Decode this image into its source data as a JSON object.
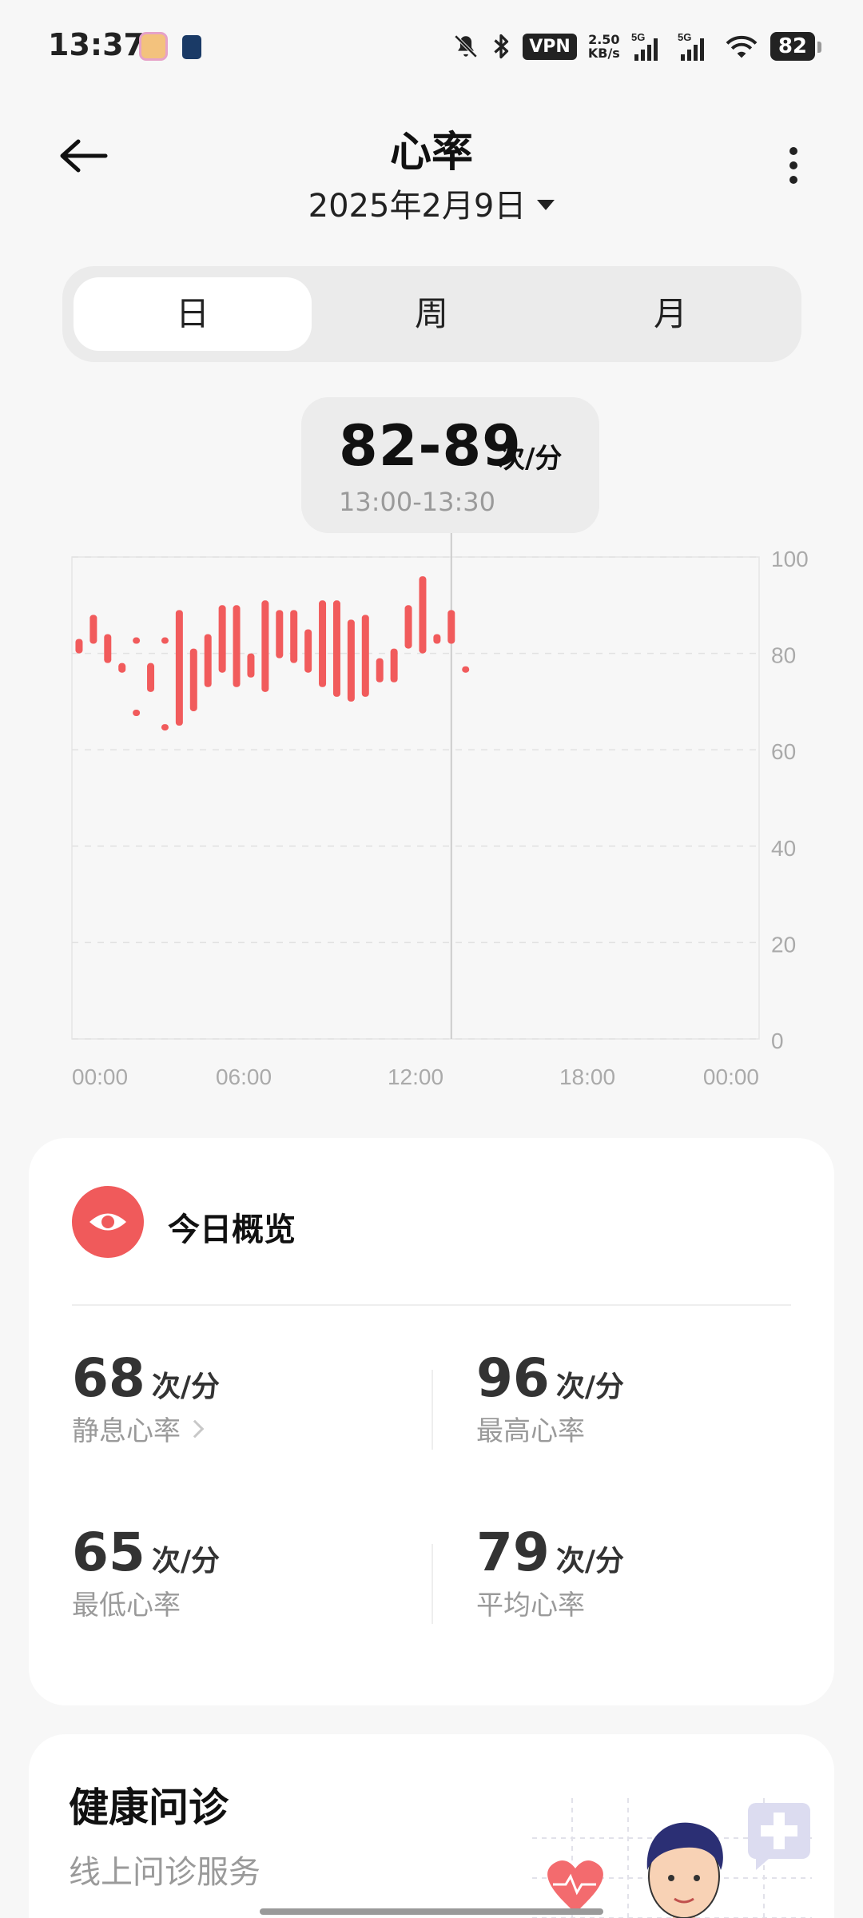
{
  "status_bar": {
    "time": "13:37",
    "vpn": "VPN",
    "net_speed_value": "2.50",
    "net_speed_unit": "KB/s",
    "signal1_label": "5G",
    "signal2_label": "5G",
    "battery": "82",
    "icons": [
      "dnd-bell-off-icon",
      "bluetooth-icon",
      "signal-icon",
      "signal-icon",
      "wifi-icon",
      "battery-icon"
    ]
  },
  "header": {
    "title": "心率",
    "date": "2025年2月9日"
  },
  "tabs": [
    {
      "label": "日",
      "active": true
    },
    {
      "label": "周",
      "active": false
    },
    {
      "label": "月",
      "active": false
    }
  ],
  "tooltip": {
    "range": "82-89",
    "unit": "次/分",
    "time": "13:00-13:30"
  },
  "chart_data": {
    "type": "bar",
    "bar_style": "floating range (min-max per 30-minute interval)",
    "color": "#f15b5c",
    "x_ticks": [
      "00:00",
      "06:00",
      "12:00",
      "18:00",
      "00:00"
    ],
    "y_ticks": [
      100,
      80,
      60,
      40,
      20,
      0
    ],
    "ylim": [
      0,
      100
    ],
    "x_range_hours": [
      0,
      24
    ],
    "grid": "dashed",
    "cursor_hour": 13.25,
    "intervals": [
      {
        "t": 0.25,
        "min": 80,
        "max": 83
      },
      {
        "t": 0.75,
        "min": 82,
        "max": 88
      },
      {
        "t": 1.25,
        "min": 78,
        "max": 84
      },
      {
        "t": 1.75,
        "min": 76,
        "max": 78
      },
      {
        "t": 2.25,
        "min": 82,
        "max": 83
      },
      {
        "t": 2.25,
        "min": 67,
        "max": 68
      },
      {
        "t": 2.75,
        "min": 72,
        "max": 78
      },
      {
        "t": 3.25,
        "min": 82,
        "max": 83
      },
      {
        "t": 3.25,
        "min": 64,
        "max": 65
      },
      {
        "t": 3.75,
        "min": 65,
        "max": 89
      },
      {
        "t": 4.25,
        "min": 68,
        "max": 81
      },
      {
        "t": 4.75,
        "min": 73,
        "max": 84
      },
      {
        "t": 5.25,
        "min": 76,
        "max": 90
      },
      {
        "t": 5.75,
        "min": 73,
        "max": 90
      },
      {
        "t": 6.25,
        "min": 75,
        "max": 80
      },
      {
        "t": 6.75,
        "min": 72,
        "max": 91
      },
      {
        "t": 7.25,
        "min": 79,
        "max": 89
      },
      {
        "t": 7.75,
        "min": 78,
        "max": 89
      },
      {
        "t": 8.25,
        "min": 76,
        "max": 85
      },
      {
        "t": 8.75,
        "min": 73,
        "max": 91
      },
      {
        "t": 9.25,
        "min": 71,
        "max": 91
      },
      {
        "t": 9.75,
        "min": 70,
        "max": 87
      },
      {
        "t": 10.25,
        "min": 71,
        "max": 88
      },
      {
        "t": 10.75,
        "min": 74,
        "max": 79
      },
      {
        "t": 11.25,
        "min": 74,
        "max": 81
      },
      {
        "t": 11.75,
        "min": 81,
        "max": 90
      },
      {
        "t": 12.25,
        "min": 80,
        "max": 96
      },
      {
        "t": 12.75,
        "min": 82,
        "max": 84
      },
      {
        "t": 13.25,
        "min": 82,
        "max": 89
      },
      {
        "t": 13.75,
        "min": 76,
        "max": 77
      }
    ]
  },
  "overview": {
    "title": "今日概览",
    "icon": "eye-icon",
    "stats": [
      {
        "value": "68",
        "unit": "次/分",
        "label": "静息心率"
      },
      {
        "value": "96",
        "unit": "次/分",
        "label": "最高心率"
      },
      {
        "value": "65",
        "unit": "次/分",
        "label": "最低心率"
      },
      {
        "value": "79",
        "unit": "次/分",
        "label": "平均心率"
      }
    ]
  },
  "consult": {
    "title": "健康问诊",
    "subtitle": "线上问诊服务"
  }
}
